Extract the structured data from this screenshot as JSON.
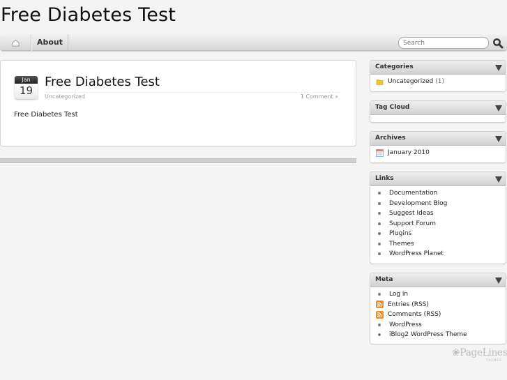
{
  "site": {
    "title": "Free Diabetes Test"
  },
  "nav": {
    "home_icon": "home-icon",
    "items": [
      {
        "label": "About"
      }
    ],
    "search": {
      "placeholder": "Search",
      "value": "",
      "icon": "search-icon"
    }
  },
  "post": {
    "date": {
      "month": "Jan",
      "day": "19"
    },
    "title": "Free Diabetes Test",
    "category": "Uncategorized",
    "comments": "1 Comment »",
    "body": "Free Diabetes Test"
  },
  "sidebar": {
    "widgets": [
      {
        "title": "Categories",
        "items": [
          {
            "label": "Uncategorized",
            "count": "(1)",
            "icon": "folder-icon"
          }
        ]
      },
      {
        "title": "Tag Cloud",
        "items": []
      },
      {
        "title": "Archives",
        "items": [
          {
            "label": "January 2010",
            "icon": "calendar-icon"
          }
        ]
      },
      {
        "title": "Links",
        "items": [
          {
            "label": "Documentation"
          },
          {
            "label": "Development Blog"
          },
          {
            "label": "Suggest Ideas"
          },
          {
            "label": "Support Forum"
          },
          {
            "label": "Plugins"
          },
          {
            "label": "Themes"
          },
          {
            "label": "WordPress Planet"
          }
        ]
      },
      {
        "title": "Meta",
        "items": [
          {
            "label": "Log in",
            "icon": "bullet"
          },
          {
            "label": "Entries (RSS)",
            "icon": "rss-icon"
          },
          {
            "label": "Comments (RSS)",
            "icon": "rss-icon"
          },
          {
            "label": "WordPress",
            "icon": "bullet"
          },
          {
            "label": "iBlog2 WordPress Theme",
            "icon": "bullet"
          }
        ]
      }
    ]
  },
  "footer": {
    "logo_text": "PageLines",
    "logo_sub": "THEMES"
  },
  "colors": {
    "rss": "#f08a24",
    "folder": "#f3c230",
    "calendar": "#7aa7d8"
  }
}
